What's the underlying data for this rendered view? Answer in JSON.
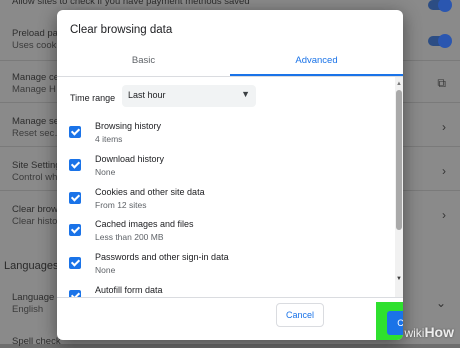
{
  "background": {
    "rows": [
      {
        "title": "Allow sites to check if you have payment methods saved",
        "sub": ""
      },
      {
        "title": "Preload pa…",
        "sub": "Uses cook…"
      },
      {
        "title": "Manage ce…",
        "sub": "Manage H…"
      },
      {
        "title": "Manage se…",
        "sub": "Reset sec…"
      },
      {
        "title": "Site Setting…",
        "sub": "Control wh…"
      },
      {
        "title": "Clear brows…",
        "sub": "Clear histo…"
      }
    ],
    "languages_heading": "Languages",
    "language_row": {
      "title": "Language",
      "sub": "English"
    },
    "spell_check": "Spell check"
  },
  "dialog": {
    "title": "Clear browsing data",
    "tabs": [
      {
        "label": "Basic",
        "active": false
      },
      {
        "label": "Advanced",
        "active": true
      }
    ],
    "time_range": {
      "label": "Time range",
      "value": "Last hour"
    },
    "items": [
      {
        "label": "Browsing history",
        "sub": "4 items",
        "checked": true
      },
      {
        "label": "Download history",
        "sub": "None",
        "checked": true
      },
      {
        "label": "Cookies and other site data",
        "sub": "From 12 sites",
        "checked": true
      },
      {
        "label": "Cached images and files",
        "sub": "Less than 200 MB",
        "checked": true
      },
      {
        "label": "Passwords and other sign-in data",
        "sub": "None",
        "checked": true
      },
      {
        "label": "Autofill form data",
        "sub": "",
        "checked": true
      }
    ],
    "buttons": {
      "cancel": "Cancel",
      "clear": "Clear data"
    }
  },
  "watermark": {
    "wiki": "wiki",
    "how": "How"
  },
  "colors": {
    "accent": "#1a73e8",
    "highlight": "#2ee02e"
  }
}
